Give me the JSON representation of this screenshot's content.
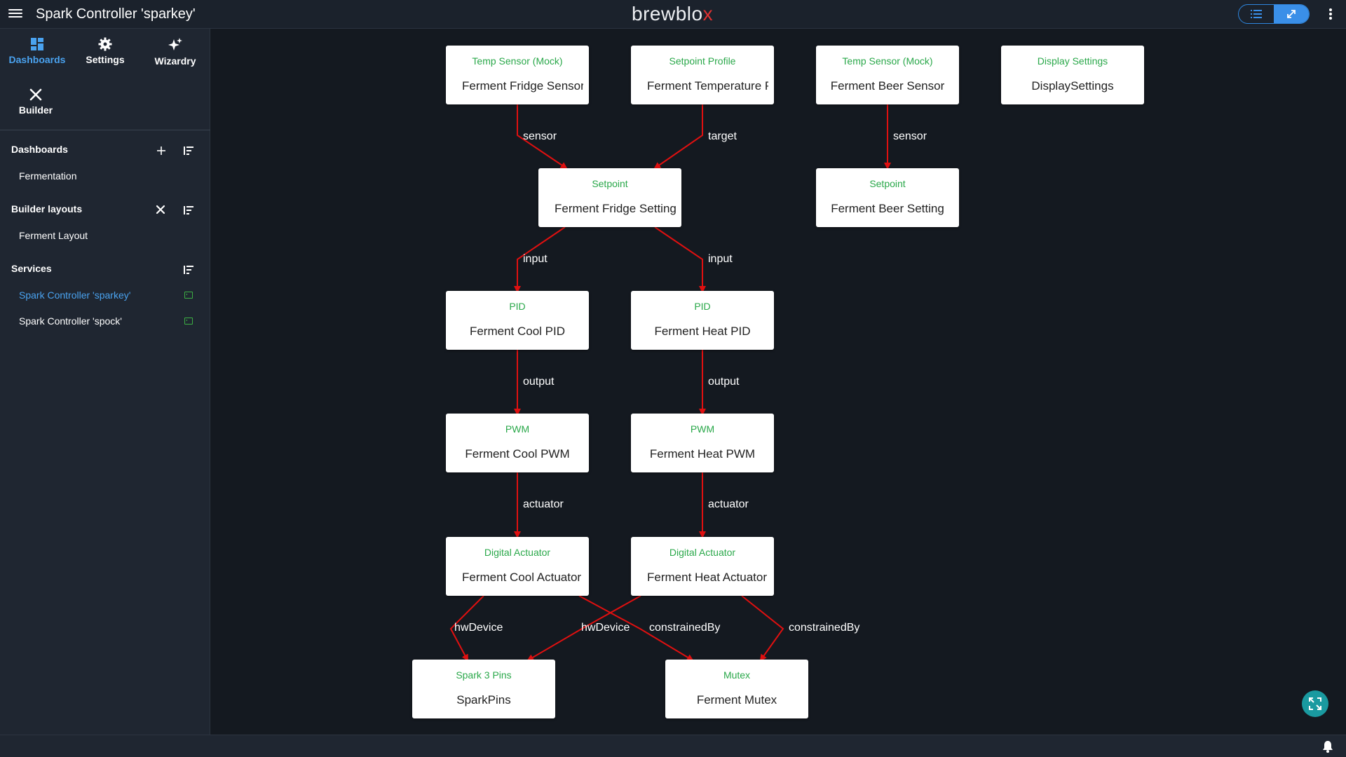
{
  "header": {
    "title": "Spark Controller 'sparkey'",
    "logo_main": "brewblo",
    "logo_accent": "x"
  },
  "sidebar": {
    "nav": [
      {
        "label": "Dashboards",
        "icon": "dashboard-icon",
        "active": true
      },
      {
        "label": "Settings",
        "icon": "gear-icon",
        "active": false
      },
      {
        "label": "Wizardry",
        "icon": "sparkles-icon",
        "active": false
      },
      {
        "label": "Builder",
        "icon": "tools-icon",
        "active": false
      }
    ],
    "sections": {
      "dashboards": {
        "title": "Dashboards",
        "items": [
          "Fermentation"
        ]
      },
      "builder": {
        "title": "Builder layouts",
        "items": [
          "Ferment Layout"
        ]
      },
      "services": {
        "title": "Services",
        "items": [
          "Spark Controller 'sparkey'",
          "Spark Controller 'spock'"
        ]
      }
    }
  },
  "diagram": {
    "blocks": [
      {
        "type": "Temp Sensor (Mock)",
        "name": "Ferment Fridge Sensor"
      },
      {
        "type": "Setpoint Profile",
        "name": "Ferment Temperature Profile"
      },
      {
        "type": "Temp Sensor (Mock)",
        "name": "Ferment Beer Sensor"
      },
      {
        "type": "Display Settings",
        "name": "DisplaySettings"
      },
      {
        "type": "Setpoint",
        "name": "Ferment Fridge Setting"
      },
      {
        "type": "Setpoint",
        "name": "Ferment Beer Setting"
      },
      {
        "type": "PID",
        "name": "Ferment Cool PID"
      },
      {
        "type": "PID",
        "name": "Ferment Heat PID"
      },
      {
        "type": "PWM",
        "name": "Ferment Cool PWM"
      },
      {
        "type": "PWM",
        "name": "Ferment Heat PWM"
      },
      {
        "type": "Digital Actuator",
        "name": "Ferment Cool Actuator"
      },
      {
        "type": "Digital Actuator",
        "name": "Ferment Heat Actuator"
      },
      {
        "type": "Spark 3 Pins",
        "name": "SparkPins"
      },
      {
        "type": "Mutex",
        "name": "Ferment Mutex"
      }
    ],
    "relations": [
      "sensor",
      "target",
      "sensor",
      "input",
      "input",
      "output",
      "output",
      "actuator",
      "actuator",
      "hwDevice",
      "hwDevice",
      "constrainedBy",
      "constrainedBy"
    ],
    "link_color": "#e01010"
  }
}
